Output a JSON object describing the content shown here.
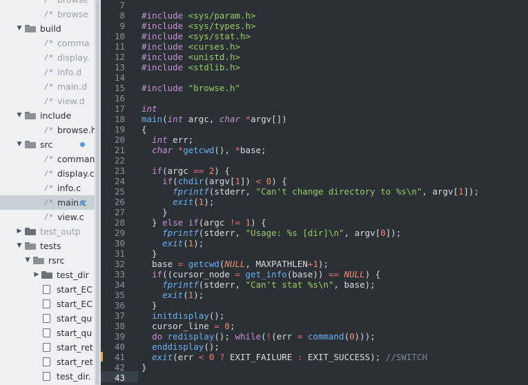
{
  "sidebar": {
    "rows": [
      {
        "type": "file",
        "label": "browse",
        "depth": 2,
        "dim": true,
        "cut": "top"
      },
      {
        "type": "file",
        "label": "browse",
        "depth": 2,
        "dim": true
      },
      {
        "type": "folder",
        "label": "build",
        "depth": 1,
        "open": true
      },
      {
        "type": "file",
        "label": "comma",
        "depth": 2,
        "dim": true
      },
      {
        "type": "file",
        "label": "display.",
        "depth": 2,
        "dim": true
      },
      {
        "type": "file",
        "label": "info.d",
        "depth": 2,
        "dim": true
      },
      {
        "type": "file",
        "label": "main.d",
        "depth": 2,
        "dim": true
      },
      {
        "type": "file",
        "label": "view.d",
        "depth": 2,
        "dim": true
      },
      {
        "type": "folder",
        "label": "include",
        "depth": 1,
        "open": true
      },
      {
        "type": "file",
        "label": "browse.h",
        "depth": 2
      },
      {
        "type": "folder",
        "label": "src",
        "depth": 1,
        "open": true,
        "modified": true
      },
      {
        "type": "file",
        "label": "command",
        "depth": 2
      },
      {
        "type": "file",
        "label": "display.c",
        "depth": 2
      },
      {
        "type": "file",
        "label": "info.c",
        "depth": 2
      },
      {
        "type": "file",
        "label": "main.c",
        "depth": 2,
        "selected": true,
        "modified": true
      },
      {
        "type": "file",
        "label": "view.c",
        "depth": 2
      },
      {
        "type": "folder",
        "label": "test_outp",
        "depth": 1,
        "open": false,
        "dim": true
      },
      {
        "type": "folder",
        "label": "tests",
        "depth": 1,
        "open": true
      },
      {
        "type": "folder",
        "label": "rsrc",
        "depth": 2,
        "open": true
      },
      {
        "type": "folder",
        "label": "test_dir",
        "depth": 3,
        "open": false
      },
      {
        "type": "doc",
        "label": "start_EC",
        "depth": 3
      },
      {
        "type": "doc",
        "label": "start_EC",
        "depth": 3
      },
      {
        "type": "doc",
        "label": "start_qu",
        "depth": 3
      },
      {
        "type": "doc",
        "label": "start_qu",
        "depth": 3
      },
      {
        "type": "doc",
        "label": "start_ret",
        "depth": 3
      },
      {
        "type": "doc",
        "label": "start_ret",
        "depth": 3
      },
      {
        "type": "doc",
        "label": "test_dir.",
        "depth": 3
      }
    ],
    "icons": {
      "c_file": "/*",
      "folder_open": "folder-open-icon",
      "folder_closed": "folder-closed-icon",
      "doc": "document-icon"
    },
    "modified_dot_color": "#5b9bd5"
  },
  "editor": {
    "current_line": 43,
    "lines": [
      {
        "n": 7,
        "t": []
      },
      {
        "n": 8,
        "t": [
          [
            "pp",
            "#include "
          ],
          [
            "str",
            "<sys/param.h>"
          ]
        ]
      },
      {
        "n": 9,
        "t": [
          [
            "pp",
            "#include "
          ],
          [
            "str",
            "<sys/types.h>"
          ]
        ]
      },
      {
        "n": 10,
        "t": [
          [
            "pp",
            "#include "
          ],
          [
            "str",
            "<sys/stat.h>"
          ]
        ]
      },
      {
        "n": 11,
        "t": [
          [
            "pp",
            "#include "
          ],
          [
            "str",
            "<curses.h>"
          ]
        ]
      },
      {
        "n": 12,
        "t": [
          [
            "pp",
            "#include "
          ],
          [
            "str",
            "<unistd.h>"
          ]
        ]
      },
      {
        "n": 13,
        "t": [
          [
            "pp",
            "#include "
          ],
          [
            "str",
            "<stdlib.h>"
          ]
        ]
      },
      {
        "n": 14,
        "t": []
      },
      {
        "n": 15,
        "t": [
          [
            "pp",
            "#include "
          ],
          [
            "str",
            "\"browse.h\""
          ]
        ]
      },
      {
        "n": 16,
        "t": []
      },
      {
        "n": 17,
        "t": [
          [
            "ty",
            "int"
          ]
        ]
      },
      {
        "n": 18,
        "t": [
          [
            "fn",
            "main"
          ],
          [
            "plain",
            "("
          ],
          [
            "ty",
            "int"
          ],
          [
            "plain",
            " argc, "
          ],
          [
            "ty",
            "char"
          ],
          [
            "plain",
            " "
          ],
          [
            "op",
            "*"
          ],
          [
            "plain",
            "argv[])"
          ]
        ]
      },
      {
        "n": 19,
        "t": [
          [
            "plain",
            "{"
          ]
        ]
      },
      {
        "n": 20,
        "t": [
          [
            "plain",
            "  "
          ],
          [
            "ty",
            "int"
          ],
          [
            "plain",
            " err;"
          ]
        ]
      },
      {
        "n": 21,
        "t": [
          [
            "plain",
            "  "
          ],
          [
            "ty",
            "char"
          ],
          [
            "plain",
            " "
          ],
          [
            "op",
            "*"
          ],
          [
            "fn",
            "getcwd"
          ],
          [
            "plain",
            "(), "
          ],
          [
            "op",
            "*"
          ],
          [
            "plain",
            "base;"
          ]
        ]
      },
      {
        "n": 22,
        "t": []
      },
      {
        "n": 23,
        "t": [
          [
            "plain",
            "  "
          ],
          [
            "kw",
            "if"
          ],
          [
            "plain",
            "(argc "
          ],
          [
            "op",
            "=="
          ],
          [
            "plain",
            " "
          ],
          [
            "num",
            "2"
          ],
          [
            "plain",
            ") {"
          ]
        ]
      },
      {
        "n": 24,
        "t": [
          [
            "plain",
            "    "
          ],
          [
            "kw",
            "if"
          ],
          [
            "plain",
            "("
          ],
          [
            "fn",
            "chdir"
          ],
          [
            "plain",
            "(argv["
          ],
          [
            "num",
            "1"
          ],
          [
            "plain",
            "]) "
          ],
          [
            "op",
            "<"
          ],
          [
            "plain",
            " "
          ],
          [
            "num",
            "0"
          ],
          [
            "plain",
            ") {"
          ]
        ]
      },
      {
        "n": 25,
        "t": [
          [
            "plain",
            "      "
          ],
          [
            "fni",
            "fprintf"
          ],
          [
            "plain",
            "(stderr, "
          ],
          [
            "str",
            "\"Can't change directory to %s\\n\""
          ],
          [
            "plain",
            ", argv["
          ],
          [
            "num",
            "1"
          ],
          [
            "plain",
            "]);"
          ]
        ]
      },
      {
        "n": 26,
        "t": [
          [
            "plain",
            "      "
          ],
          [
            "fni",
            "exit"
          ],
          [
            "plain",
            "("
          ],
          [
            "num",
            "1"
          ],
          [
            "plain",
            ");"
          ]
        ]
      },
      {
        "n": 27,
        "t": [
          [
            "plain",
            "    }"
          ]
        ]
      },
      {
        "n": 28,
        "t": [
          [
            "plain",
            "  } "
          ],
          [
            "kw",
            "else if"
          ],
          [
            "plain",
            "(argc "
          ],
          [
            "op",
            "!="
          ],
          [
            "plain",
            " "
          ],
          [
            "num",
            "1"
          ],
          [
            "plain",
            ") {"
          ]
        ]
      },
      {
        "n": 29,
        "t": [
          [
            "plain",
            "    "
          ],
          [
            "fni",
            "fprintf"
          ],
          [
            "plain",
            "(stderr, "
          ],
          [
            "str",
            "\"Usage: %s [dir]\\n\""
          ],
          [
            "plain",
            ", argv["
          ],
          [
            "num",
            "0"
          ],
          [
            "plain",
            "]);"
          ]
        ]
      },
      {
        "n": 30,
        "t": [
          [
            "plain",
            "    "
          ],
          [
            "fni",
            "exit"
          ],
          [
            "plain",
            "("
          ],
          [
            "num",
            "1"
          ],
          [
            "plain",
            ");"
          ]
        ]
      },
      {
        "n": 31,
        "t": [
          [
            "plain",
            "  }"
          ]
        ]
      },
      {
        "n": 32,
        "t": [
          [
            "plain",
            "  base "
          ],
          [
            "op",
            "="
          ],
          [
            "plain",
            " "
          ],
          [
            "fn",
            "getcwd"
          ],
          [
            "plain",
            "("
          ],
          [
            "nul",
            "NULL"
          ],
          [
            "plain",
            ", MAXPATHLEN"
          ],
          [
            "op",
            "+"
          ],
          [
            "num",
            "1"
          ],
          [
            "plain",
            ");"
          ]
        ]
      },
      {
        "n": 33,
        "t": [
          [
            "plain",
            "  "
          ],
          [
            "kw",
            "if"
          ],
          [
            "plain",
            "((cursor_node "
          ],
          [
            "op",
            "="
          ],
          [
            "plain",
            " "
          ],
          [
            "fn",
            "get_info"
          ],
          [
            "plain",
            "(base)) "
          ],
          [
            "op",
            "=="
          ],
          [
            "plain",
            " "
          ],
          [
            "nul",
            "NULL"
          ],
          [
            "plain",
            ") {"
          ]
        ]
      },
      {
        "n": 34,
        "t": [
          [
            "plain",
            "    "
          ],
          [
            "fni",
            "fprintf"
          ],
          [
            "plain",
            "(stderr, "
          ],
          [
            "str",
            "\"Can't stat %s\\n\""
          ],
          [
            "plain",
            ", base);"
          ]
        ]
      },
      {
        "n": 35,
        "t": [
          [
            "plain",
            "    "
          ],
          [
            "fni",
            "exit"
          ],
          [
            "plain",
            "("
          ],
          [
            "num",
            "1"
          ],
          [
            "plain",
            ");"
          ]
        ]
      },
      {
        "n": 36,
        "t": [
          [
            "plain",
            "  }"
          ]
        ]
      },
      {
        "n": 37,
        "t": [
          [
            "plain",
            "  "
          ],
          [
            "fn",
            "initdisplay"
          ],
          [
            "plain",
            "();"
          ]
        ]
      },
      {
        "n": 38,
        "t": [
          [
            "plain",
            "  cursor_line "
          ],
          [
            "op",
            "="
          ],
          [
            "plain",
            " "
          ],
          [
            "num",
            "0"
          ],
          [
            "plain",
            ";"
          ]
        ]
      },
      {
        "n": 39,
        "t": [
          [
            "plain",
            "  "
          ],
          [
            "kw",
            "do"
          ],
          [
            "plain",
            " "
          ],
          [
            "fn",
            "redisplay"
          ],
          [
            "plain",
            "(); "
          ],
          [
            "kw",
            "while"
          ],
          [
            "plain",
            "("
          ],
          [
            "op",
            "!"
          ],
          [
            "plain",
            "(err "
          ],
          [
            "op",
            "="
          ],
          [
            "plain",
            " "
          ],
          [
            "fn",
            "command"
          ],
          [
            "plain",
            "("
          ],
          [
            "num",
            "0"
          ],
          [
            "plain",
            ")));"
          ]
        ]
      },
      {
        "n": 40,
        "t": [
          [
            "plain",
            "  "
          ],
          [
            "fn",
            "enddisplay"
          ],
          [
            "plain",
            "();"
          ]
        ]
      },
      {
        "n": 41,
        "t": [
          [
            "plain",
            "  "
          ],
          [
            "fni",
            "exit"
          ],
          [
            "plain",
            "(err "
          ],
          [
            "op",
            "<"
          ],
          [
            "plain",
            " "
          ],
          [
            "num",
            "0"
          ],
          [
            "plain",
            " "
          ],
          [
            "op",
            "?"
          ],
          [
            "plain",
            " EXIT_FAILURE "
          ],
          [
            "op",
            ":"
          ],
          [
            "plain",
            " EXIT_SUCCESS); "
          ],
          [
            "cm",
            "//SWITCH"
          ]
        ]
      },
      {
        "n": 42,
        "t": [
          [
            "plain",
            "}"
          ]
        ]
      },
      {
        "n": 43,
        "t": []
      }
    ]
  }
}
